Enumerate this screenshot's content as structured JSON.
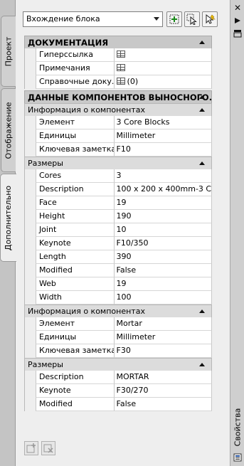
{
  "left_tabs": [
    "Проект",
    "Отображение",
    "Дополнительно"
  ],
  "window": {
    "title": "Свойства",
    "close_glyph": "✕"
  },
  "toolbar": {
    "selector_value": "Вхождение блока"
  },
  "documentation": {
    "header": "ДОКУМЕНТАЦИЯ",
    "rows": [
      {
        "name": "Гиперссылка",
        "value": ""
      },
      {
        "name": "Примечания",
        "value": ""
      },
      {
        "name": "Справочные доку...",
        "value": "(0)"
      }
    ]
  },
  "component_data": {
    "header": "ДАННЫЕ КОМПОНЕНТОВ ВЫНОСНОГО...",
    "group1_info": {
      "title": "Информация о компонентах",
      "rows": [
        {
          "name": "Элемент",
          "value": "3 Core Blocks"
        },
        {
          "name": "Единицы",
          "value": "Millimeter"
        },
        {
          "name": "Ключевая заметка",
          "value": "F10"
        }
      ]
    },
    "group1_sizes": {
      "title": "Размеры",
      "rows": [
        {
          "name": "Cores",
          "value": "3"
        },
        {
          "name": "Description",
          "value": "100 x 200 x 400mm-3 C..."
        },
        {
          "name": "Face",
          "value": "19"
        },
        {
          "name": "Height",
          "value": "190"
        },
        {
          "name": "Joint",
          "value": "10"
        },
        {
          "name": "Keynote",
          "value": "F10/350"
        },
        {
          "name": "Length",
          "value": "390"
        },
        {
          "name": "Modified",
          "value": "False"
        },
        {
          "name": "Web",
          "value": "19"
        },
        {
          "name": "Width",
          "value": "100"
        }
      ]
    },
    "group2_info": {
      "title": "Информация о компонентах",
      "rows": [
        {
          "name": "Элемент",
          "value": "Mortar"
        },
        {
          "name": "Единицы",
          "value": "Millimeter"
        },
        {
          "name": "Ключевая заметка",
          "value": "F30"
        }
      ]
    },
    "group2_sizes": {
      "title": "Размеры",
      "rows": [
        {
          "name": "Description",
          "value": "MORTAR"
        },
        {
          "name": "Keynote",
          "value": "F30/270"
        },
        {
          "name": "Modified",
          "value": "False"
        }
      ]
    }
  }
}
